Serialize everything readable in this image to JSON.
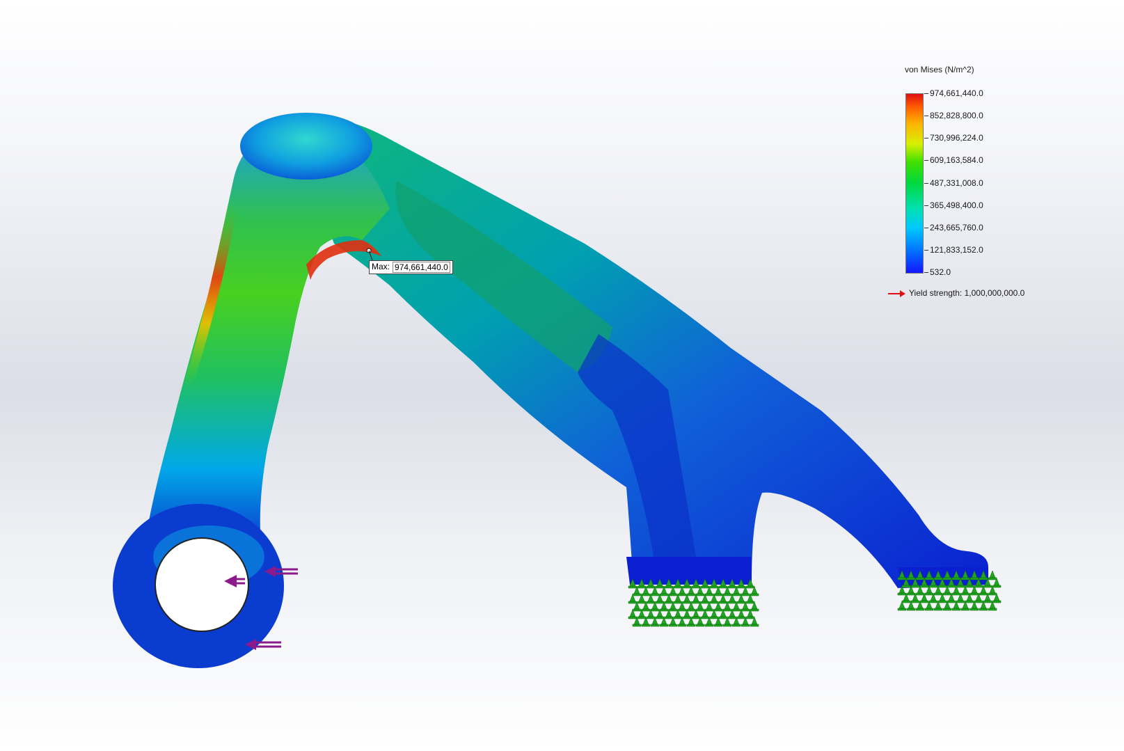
{
  "legend": {
    "title": "von Mises (N/m^2)",
    "ticks": [
      "974,661,440.0",
      "852,828,800.0",
      "730,996,224.0",
      "609,163,584.0",
      "487,331,008.0",
      "365,498,400.0",
      "243,665,760.0",
      "121,833,152.0",
      "532.0"
    ],
    "yield_label": "Yield strength:",
    "yield_value": "1,000,000,000.0"
  },
  "max_marker": {
    "label": "Max:",
    "value": "974,661,440.0"
  },
  "colors": {
    "max": "#e01010",
    "high": "#ff5a00",
    "mid_high": "#d8f000",
    "mid": "#00d840",
    "low_mid": "#00c8ff",
    "low": "#0070ff",
    "min": "#1515ff",
    "load_arrow": "#8b1a8b",
    "fixture": "#1fa51f"
  },
  "icons": {
    "load": "force-arrow-icon",
    "fixture": "fixed-geometry-icon",
    "yield": "yield-arrow-icon"
  }
}
